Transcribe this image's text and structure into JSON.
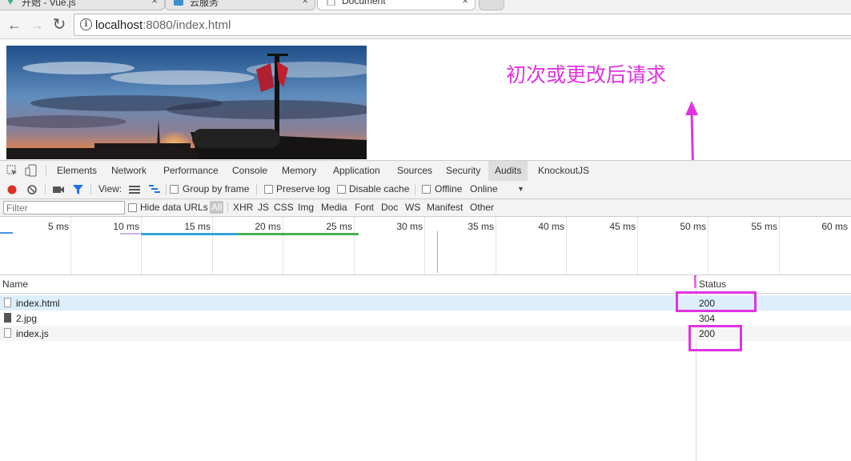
{
  "browser": {
    "tabs": [
      {
        "label": "开始 - Vue.js",
        "close": "×"
      },
      {
        "label": "云服务",
        "close": "×"
      },
      {
        "label": "Document",
        "close": "×"
      }
    ],
    "nav": {
      "back": "←",
      "forward": "→",
      "reload": "↻"
    },
    "url_host": "localhost",
    "url_rest": ":8080/index.html",
    "info_glyph": "i"
  },
  "page": {
    "annotation": "初次或更改后请求",
    "annotation_color": "#e033e3"
  },
  "devtools": {
    "tabs": [
      "Elements",
      "Network",
      "Performance",
      "Console",
      "Memory",
      "Application",
      "Sources",
      "Security",
      "Audits",
      "KnockoutJS"
    ],
    "selected_tab": "Audits",
    "toolbar": {
      "view_label": "View:",
      "group_by_frame": "Group by frame",
      "preserve_log": "Preserve log",
      "disable_cache": "Disable cache",
      "offline": "Offline",
      "throttle": "Online",
      "dropdown_arrow": "▼"
    },
    "filter": {
      "placeholder": "Filter",
      "hide_data_urls": "Hide data URLs",
      "types": [
        "All",
        "XHR",
        "JS",
        "CSS",
        "Img",
        "Media",
        "Font",
        "Doc",
        "WS",
        "Manifest",
        "Other"
      ],
      "active_type": "All"
    },
    "timeline": {
      "ticks": [
        "5 ms",
        "10 ms",
        "15 ms",
        "20 ms",
        "25 ms",
        "30 ms",
        "35 ms",
        "40 ms",
        "45 ms",
        "50 ms",
        "55 ms",
        "60 ms"
      ]
    },
    "table": {
      "col_name": "Name",
      "col_status": "Status",
      "rows": [
        {
          "name": "index.html",
          "status": "200"
        },
        {
          "name": "2.jpg",
          "status": "304"
        },
        {
          "name": "index.js",
          "status": "200"
        }
      ]
    }
  }
}
